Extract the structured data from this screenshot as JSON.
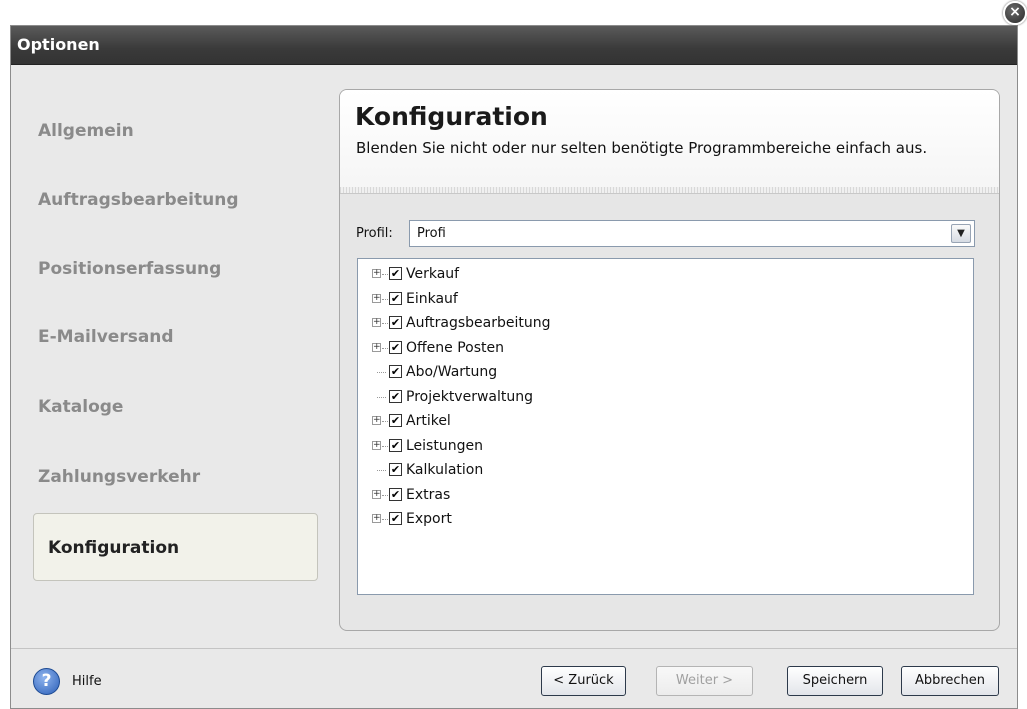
{
  "dialog": {
    "title": "Optionen",
    "close_symbol": "×"
  },
  "sidebar": {
    "items": [
      {
        "label": "Allgemein"
      },
      {
        "label": "Auftragsbearbeitung"
      },
      {
        "label": "Positionserfassung"
      },
      {
        "label": "E-Mailversand"
      },
      {
        "label": "Kataloge"
      },
      {
        "label": "Zahlungsverkehr"
      },
      {
        "label": "Konfiguration",
        "active": true
      }
    ]
  },
  "panel": {
    "title": "Konfiguration",
    "description": "Blenden Sie nicht oder nur selten benötigte Programmbereiche einfach aus.",
    "profil_label": "Profil:",
    "profil_value": "Profi",
    "dropdown_symbol": "⌄"
  },
  "tree": {
    "expand_symbol": "+",
    "check_symbol": "✔",
    "items": [
      {
        "label": "Verkauf",
        "expandable": true,
        "checked": true
      },
      {
        "label": "Einkauf",
        "expandable": true,
        "checked": true
      },
      {
        "label": "Auftragsbearbeitung",
        "expandable": true,
        "checked": true
      },
      {
        "label": "Offene Posten",
        "expandable": true,
        "checked": true
      },
      {
        "label": "Abo/Wartung",
        "expandable": false,
        "checked": true
      },
      {
        "label": "Projektverwaltung",
        "expandable": false,
        "checked": true
      },
      {
        "label": "Artikel",
        "expandable": true,
        "checked": true
      },
      {
        "label": "Leistungen",
        "expandable": true,
        "checked": true
      },
      {
        "label": "Kalkulation",
        "expandable": false,
        "checked": true
      },
      {
        "label": "Extras",
        "expandable": true,
        "checked": true
      },
      {
        "label": "Export",
        "expandable": true,
        "checked": true
      }
    ]
  },
  "footer": {
    "help_symbol": "?",
    "help_label": "Hilfe",
    "back_label": "< Zurück",
    "next_label": "Weiter >",
    "next_enabled": false,
    "save_label": "Speichern",
    "cancel_label": "Abbrechen"
  }
}
